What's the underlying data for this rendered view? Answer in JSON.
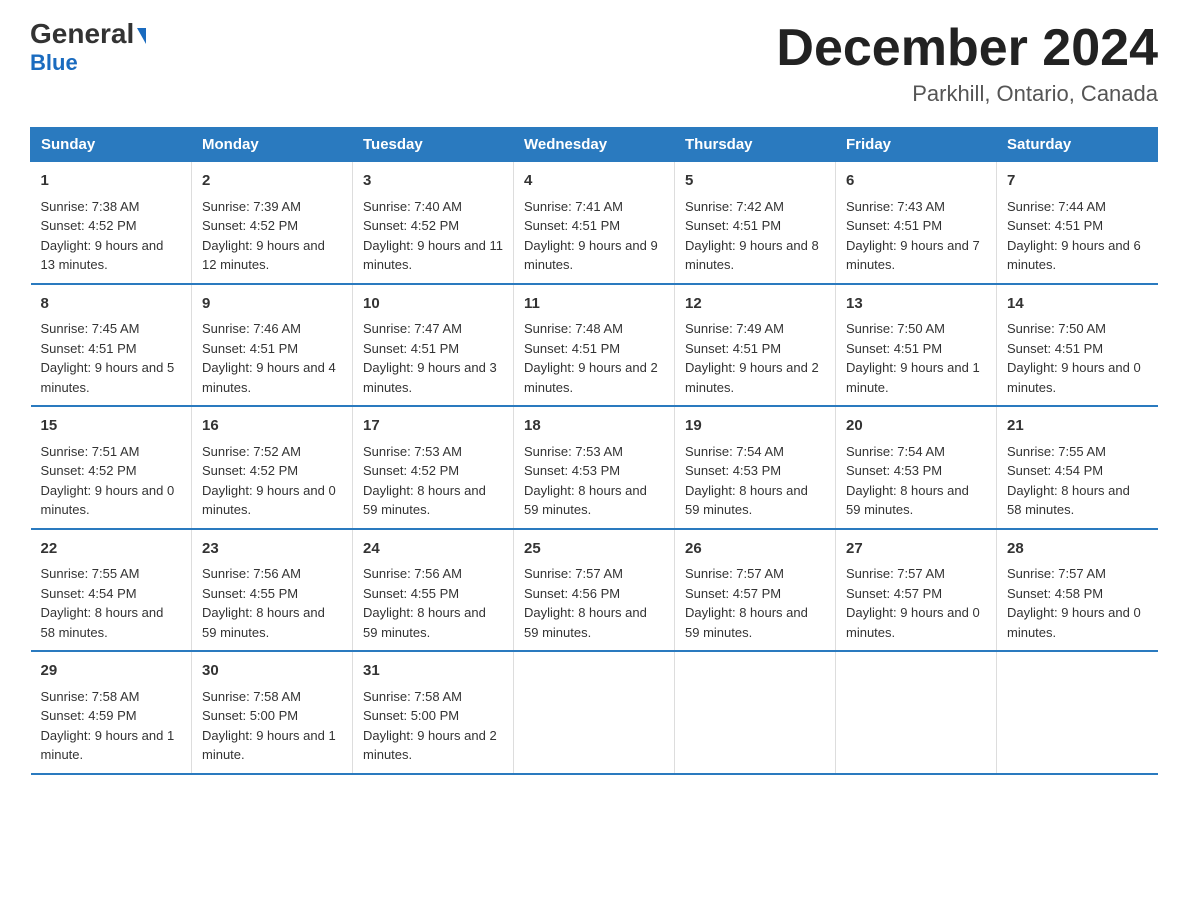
{
  "logo": {
    "part1": "General",
    "part2": "Blue"
  },
  "header": {
    "month": "December 2024",
    "location": "Parkhill, Ontario, Canada"
  },
  "weekdays": [
    "Sunday",
    "Monday",
    "Tuesday",
    "Wednesday",
    "Thursday",
    "Friday",
    "Saturday"
  ],
  "weeks": [
    [
      {
        "day": "1",
        "sunrise": "7:38 AM",
        "sunset": "4:52 PM",
        "daylight": "9 hours and 13 minutes."
      },
      {
        "day": "2",
        "sunrise": "7:39 AM",
        "sunset": "4:52 PM",
        "daylight": "9 hours and 12 minutes."
      },
      {
        "day": "3",
        "sunrise": "7:40 AM",
        "sunset": "4:52 PM",
        "daylight": "9 hours and 11 minutes."
      },
      {
        "day": "4",
        "sunrise": "7:41 AM",
        "sunset": "4:51 PM",
        "daylight": "9 hours and 9 minutes."
      },
      {
        "day": "5",
        "sunrise": "7:42 AM",
        "sunset": "4:51 PM",
        "daylight": "9 hours and 8 minutes."
      },
      {
        "day": "6",
        "sunrise": "7:43 AM",
        "sunset": "4:51 PM",
        "daylight": "9 hours and 7 minutes."
      },
      {
        "day": "7",
        "sunrise": "7:44 AM",
        "sunset": "4:51 PM",
        "daylight": "9 hours and 6 minutes."
      }
    ],
    [
      {
        "day": "8",
        "sunrise": "7:45 AM",
        "sunset": "4:51 PM",
        "daylight": "9 hours and 5 minutes."
      },
      {
        "day": "9",
        "sunrise": "7:46 AM",
        "sunset": "4:51 PM",
        "daylight": "9 hours and 4 minutes."
      },
      {
        "day": "10",
        "sunrise": "7:47 AM",
        "sunset": "4:51 PM",
        "daylight": "9 hours and 3 minutes."
      },
      {
        "day": "11",
        "sunrise": "7:48 AM",
        "sunset": "4:51 PM",
        "daylight": "9 hours and 2 minutes."
      },
      {
        "day": "12",
        "sunrise": "7:49 AM",
        "sunset": "4:51 PM",
        "daylight": "9 hours and 2 minutes."
      },
      {
        "day": "13",
        "sunrise": "7:50 AM",
        "sunset": "4:51 PM",
        "daylight": "9 hours and 1 minute."
      },
      {
        "day": "14",
        "sunrise": "7:50 AM",
        "sunset": "4:51 PM",
        "daylight": "9 hours and 0 minutes."
      }
    ],
    [
      {
        "day": "15",
        "sunrise": "7:51 AM",
        "sunset": "4:52 PM",
        "daylight": "9 hours and 0 minutes."
      },
      {
        "day": "16",
        "sunrise": "7:52 AM",
        "sunset": "4:52 PM",
        "daylight": "9 hours and 0 minutes."
      },
      {
        "day": "17",
        "sunrise": "7:53 AM",
        "sunset": "4:52 PM",
        "daylight": "8 hours and 59 minutes."
      },
      {
        "day": "18",
        "sunrise": "7:53 AM",
        "sunset": "4:53 PM",
        "daylight": "8 hours and 59 minutes."
      },
      {
        "day": "19",
        "sunrise": "7:54 AM",
        "sunset": "4:53 PM",
        "daylight": "8 hours and 59 minutes."
      },
      {
        "day": "20",
        "sunrise": "7:54 AM",
        "sunset": "4:53 PM",
        "daylight": "8 hours and 59 minutes."
      },
      {
        "day": "21",
        "sunrise": "7:55 AM",
        "sunset": "4:54 PM",
        "daylight": "8 hours and 58 minutes."
      }
    ],
    [
      {
        "day": "22",
        "sunrise": "7:55 AM",
        "sunset": "4:54 PM",
        "daylight": "8 hours and 58 minutes."
      },
      {
        "day": "23",
        "sunrise": "7:56 AM",
        "sunset": "4:55 PM",
        "daylight": "8 hours and 59 minutes."
      },
      {
        "day": "24",
        "sunrise": "7:56 AM",
        "sunset": "4:55 PM",
        "daylight": "8 hours and 59 minutes."
      },
      {
        "day": "25",
        "sunrise": "7:57 AM",
        "sunset": "4:56 PM",
        "daylight": "8 hours and 59 minutes."
      },
      {
        "day": "26",
        "sunrise": "7:57 AM",
        "sunset": "4:57 PM",
        "daylight": "8 hours and 59 minutes."
      },
      {
        "day": "27",
        "sunrise": "7:57 AM",
        "sunset": "4:57 PM",
        "daylight": "9 hours and 0 minutes."
      },
      {
        "day": "28",
        "sunrise": "7:57 AM",
        "sunset": "4:58 PM",
        "daylight": "9 hours and 0 minutes."
      }
    ],
    [
      {
        "day": "29",
        "sunrise": "7:58 AM",
        "sunset": "4:59 PM",
        "daylight": "9 hours and 1 minute."
      },
      {
        "day": "30",
        "sunrise": "7:58 AM",
        "sunset": "5:00 PM",
        "daylight": "9 hours and 1 minute."
      },
      {
        "day": "31",
        "sunrise": "7:58 AM",
        "sunset": "5:00 PM",
        "daylight": "9 hours and 2 minutes."
      },
      null,
      null,
      null,
      null
    ]
  ],
  "labels": {
    "sunrise": "Sunrise:",
    "sunset": "Sunset:",
    "daylight": "Daylight:"
  }
}
